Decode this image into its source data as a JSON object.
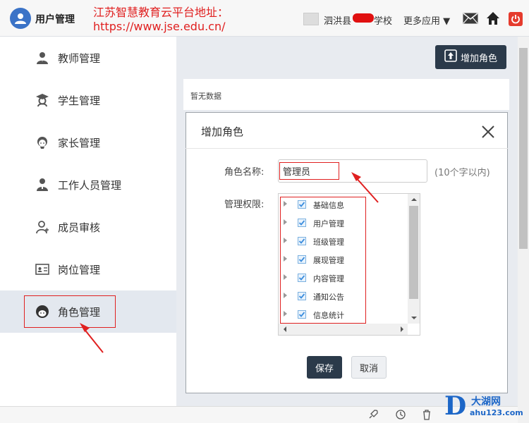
{
  "header": {
    "app_title": "用户管理",
    "annotation_line1": "江苏智慧教育云平台地址：",
    "annotation_line2": "https://www.jse.edu.cn/",
    "school_prefix": "泗洪县",
    "school_suffix": "学校",
    "more_apps": "更多应用 ▼"
  },
  "sidebar": {
    "items": [
      {
        "label": "教师管理",
        "icon": "teacher-icon"
      },
      {
        "label": "学生管理",
        "icon": "student-icon"
      },
      {
        "label": "家长管理",
        "icon": "parent-icon"
      },
      {
        "label": "工作人员管理",
        "icon": "staff-icon"
      },
      {
        "label": "成员审核",
        "icon": "member-review-icon"
      },
      {
        "label": "岗位管理",
        "icon": "position-icon"
      },
      {
        "label": "角色管理",
        "icon": "role-icon"
      }
    ],
    "active_index": 6
  },
  "main": {
    "add_role_label": "增加角色",
    "empty_text": "暂无数据"
  },
  "modal": {
    "title": "增加角色",
    "name_label": "角色名称:",
    "name_value": "管理员",
    "name_hint": "(10个字以内)",
    "perm_label": "管理权限:",
    "permissions": [
      {
        "label": "基础信息",
        "checked": true
      },
      {
        "label": "用户管理",
        "checked": true
      },
      {
        "label": "班级管理",
        "checked": true
      },
      {
        "label": "展现管理",
        "checked": true
      },
      {
        "label": "内容管理",
        "checked": true
      },
      {
        "label": "通知公告",
        "checked": true
      },
      {
        "label": "信息统计",
        "checked": true
      }
    ],
    "save_label": "保存",
    "cancel_label": "取消"
  },
  "watermark": {
    "logo_letter": "D",
    "name": "大湖网",
    "url": "ahu123.com"
  },
  "colors": {
    "primary_dark": "#2b3a4a",
    "annotation_red": "#e02020",
    "logo_blue": "#3b73c7",
    "checkbox_blue": "#3c8dde"
  }
}
